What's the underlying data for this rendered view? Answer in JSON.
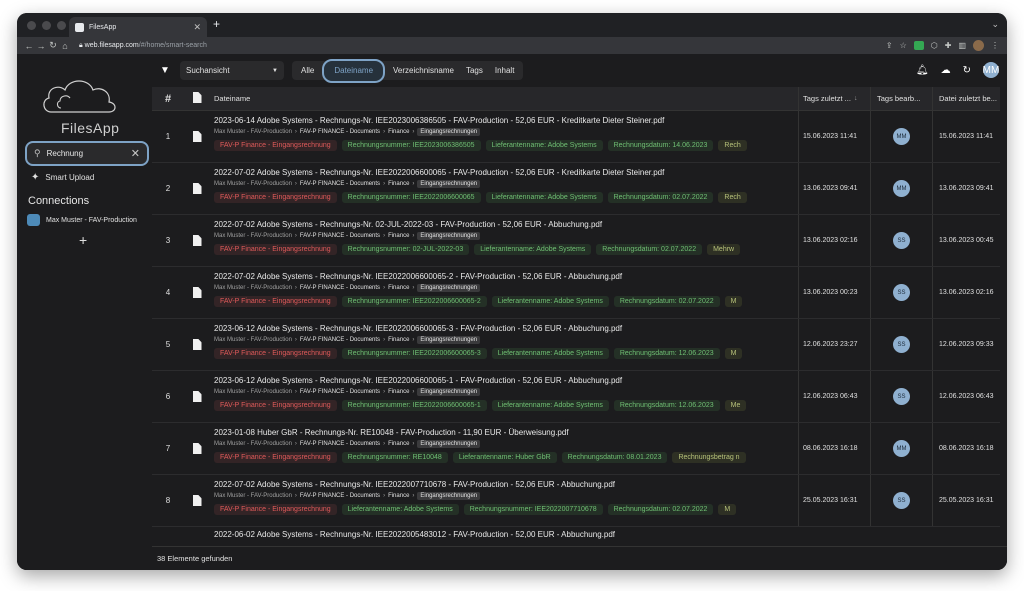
{
  "browser": {
    "tab_title": "FilesApp",
    "url_host": "web.filesapp.com",
    "url_path": "/#/home/smart-search"
  },
  "sidebar": {
    "logo_text": "FilesApp",
    "search_value": "Rechnung",
    "smart_upload": "Smart Upload",
    "connections_heading": "Connections",
    "connection": "Max Muster - FAV-Production",
    "add": "+"
  },
  "toolbar": {
    "view": "Suchansicht",
    "scopes": [
      "Alle",
      "Dateiname",
      "Verzeichnisname",
      "Tags",
      "Inhalt"
    ],
    "active_scope": "Dateiname",
    "user_initials": "MM"
  },
  "table": {
    "headers": {
      "num": "#",
      "name": "Dateiname",
      "tags_modified": "Tags zuletzt ...",
      "tags_edited_by": "Tags bearb...",
      "file_modified": "Datei zuletzt be..."
    },
    "crumb": {
      "user": "Max Muster - FAV-Production",
      "root": "FAV-P FINANCE - Documents",
      "folder": "Finance",
      "last": "Eingangsrechnungen"
    },
    "rows": [
      {
        "num": "1",
        "name": "2023-06-14 Adobe Systems - Rechnungs-Nr. IEE2023006386505 - FAV-Production - 52,06 EUR - Kreditkarte Dieter Steiner.pdf",
        "tags": [
          {
            "text": "FAV-P Finance - Eingangsrechnung",
            "color": "red"
          },
          {
            "text": "Rechnungsnummer: IEE2023006386505",
            "color": "green"
          },
          {
            "text": "Lieferantenname: Adobe Systems",
            "color": "green"
          },
          {
            "text": "Rechnungsdatum: 14.06.2023",
            "color": "green"
          },
          {
            "text": "Rech",
            "color": "olive"
          }
        ],
        "tags_modified": "15.06.2023 11:41",
        "editor": "MM",
        "file_modified": "15.06.2023 11:41"
      },
      {
        "num": "2",
        "name": "2022-07-02 Adobe Systems - Rechnungs-Nr. IEE2022006600065 - FAV-Production - 52,06 EUR - Kreditkarte Dieter Steiner.pdf",
        "tags": [
          {
            "text": "FAV-P Finance - Eingangsrechnung",
            "color": "red"
          },
          {
            "text": "Rechnungsnummer: IEE2022006600065",
            "color": "green"
          },
          {
            "text": "Lieferantenname: Adobe Systems",
            "color": "green"
          },
          {
            "text": "Rechnungsdatum: 02.07.2022",
            "color": "green"
          },
          {
            "text": "Rech",
            "color": "olive"
          }
        ],
        "tags_modified": "13.06.2023 09:41",
        "editor": "MM",
        "file_modified": "13.06.2023 09:41"
      },
      {
        "num": "3",
        "name": "2022-07-02 Adobe Systems - Rechnungs-Nr. 02-JUL-2022-03 - FAV-Production - 52,06 EUR - Abbuchung.pdf",
        "tags": [
          {
            "text": "FAV-P Finance - Eingangsrechnung",
            "color": "red"
          },
          {
            "text": "Rechnungsnummer: 02-JUL-2022-03",
            "color": "green"
          },
          {
            "text": "Lieferantenname: Adobe Systems",
            "color": "green"
          },
          {
            "text": "Rechnungsdatum: 02.07.2022",
            "color": "green"
          },
          {
            "text": "Mehrw",
            "color": "olive"
          }
        ],
        "tags_modified": "13.06.2023 02:16",
        "editor": "SS",
        "file_modified": "13.06.2023 00:45"
      },
      {
        "num": "4",
        "name": "2022-07-02 Adobe Systems - Rechnungs-Nr. IEE2022006600065-2 - FAV-Production - 52,06 EUR - Abbuchung.pdf",
        "tags": [
          {
            "text": "FAV-P Finance - Eingangsrechnung",
            "color": "red"
          },
          {
            "text": "Rechnungsnummer: IEE2022006600065-2",
            "color": "green"
          },
          {
            "text": "Lieferantenname: Adobe Systems",
            "color": "green"
          },
          {
            "text": "Rechnungsdatum: 02.07.2022",
            "color": "green"
          },
          {
            "text": "M",
            "color": "olive"
          }
        ],
        "tags_modified": "13.06.2023 00:23",
        "editor": "SS",
        "file_modified": "13.06.2023 02:16"
      },
      {
        "num": "5",
        "name": "2023-06-12 Adobe Systems - Rechnungs-Nr. IEE2022006600065-3 - FAV-Production - 52,06 EUR - Abbuchung.pdf",
        "tags": [
          {
            "text": "FAV-P Finance - Eingangsrechnung",
            "color": "red"
          },
          {
            "text": "Rechnungsnummer: IEE2022006600065-3",
            "color": "green"
          },
          {
            "text": "Lieferantenname: Adobe Systems",
            "color": "green"
          },
          {
            "text": "Rechnungsdatum: 12.06.2023",
            "color": "green"
          },
          {
            "text": "M",
            "color": "olive"
          }
        ],
        "tags_modified": "12.06.2023 23:27",
        "editor": "SS",
        "file_modified": "12.06.2023 09:33"
      },
      {
        "num": "6",
        "name": "2023-06-12 Adobe Systems - Rechnungs-Nr. IEE2022006600065-1 - FAV-Production - 52,06 EUR - Abbuchung.pdf",
        "tags": [
          {
            "text": "FAV-P Finance - Eingangsrechnung",
            "color": "red"
          },
          {
            "text": "Rechnungsnummer: IEE2022006600065-1",
            "color": "green"
          },
          {
            "text": "Lieferantenname: Adobe Systems",
            "color": "green"
          },
          {
            "text": "Rechnungsdatum: 12.06.2023",
            "color": "green"
          },
          {
            "text": "Me",
            "color": "olive"
          }
        ],
        "tags_modified": "12.06.2023 06:43",
        "editor": "SS",
        "file_modified": "12.06.2023 06:43"
      },
      {
        "num": "7",
        "name": "2023-01-08 Huber GbR - Rechnungs-Nr. RE10048 - FAV-Production - 11,90 EUR - Überweisung.pdf",
        "tags": [
          {
            "text": "FAV-P Finance - Eingangsrechnung",
            "color": "red"
          },
          {
            "text": "Rechnungsnummer: RE10048",
            "color": "green"
          },
          {
            "text": "Lieferantenname: Huber GbR",
            "color": "green"
          },
          {
            "text": "Rechnungsdatum: 08.01.2023",
            "color": "green"
          },
          {
            "text": "Rechnungsbetrag n",
            "color": "olive"
          }
        ],
        "tags_modified": "08.06.2023 16:18",
        "editor": "MM",
        "file_modified": "08.06.2023 16:18"
      },
      {
        "num": "8",
        "name": "2022-07-02 Adobe Systems - Rechnungs-Nr. IEE2022007710678 - FAV-Production - 52,06 EUR - Abbuchung.pdf",
        "tags": [
          {
            "text": "FAV-P Finance - Eingangsrechnung",
            "color": "red"
          },
          {
            "text": "Lieferantenname: Adobe Systems",
            "color": "green"
          },
          {
            "text": "Rechnungsnummer: IEE2022007710678",
            "color": "green"
          },
          {
            "text": "Rechnungsdatum: 02.07.2022",
            "color": "green"
          },
          {
            "text": "M",
            "color": "olive"
          }
        ],
        "tags_modified": "25.05.2023 16:31",
        "editor": "SS",
        "file_modified": "25.05.2023 16:31"
      }
    ],
    "partial_row": "2022-06-02 Adobe Systems - Rechnungs-Nr. IEE2022005483012 - FAV-Production - 52,00 EUR - Abbuchung.pdf"
  },
  "footer": {
    "count_text": "38 Elemente gefunden"
  }
}
